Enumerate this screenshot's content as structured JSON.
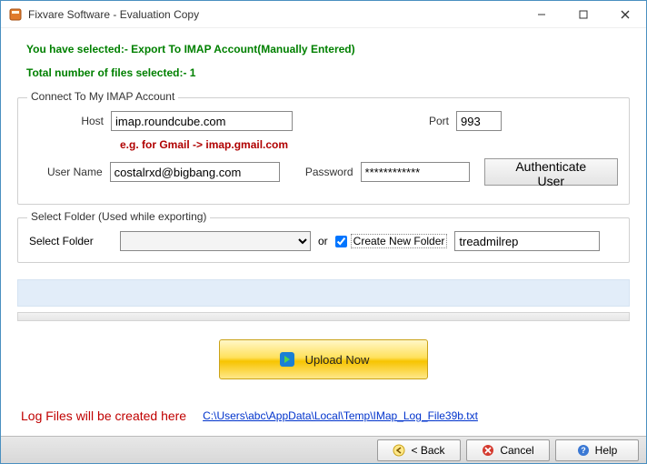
{
  "window": {
    "title": "Fixvare Software - Evaluation Copy"
  },
  "info": {
    "selected": "You have selected:- Export To IMAP Account(Manually Entered)",
    "file_count": "Total number of files selected:- 1"
  },
  "imap": {
    "legend": "Connect To My IMAP Account",
    "host_label": "Host",
    "host_value": "imap.roundcube.com",
    "port_label": "Port",
    "port_value": "993",
    "hint": "e.g. for Gmail -> imap.gmail.com",
    "user_label": "User Name",
    "user_value": "costalrxd@bigbang.com",
    "pass_label": "Password",
    "pass_value": "************",
    "auth_button": "Authenticate User"
  },
  "folder": {
    "legend": "Select Folder (Used while exporting)",
    "select_label": "Select Folder",
    "or": "or",
    "create_label": "Create New Folder",
    "create_checked": true,
    "new_folder_value": "treadmilrep"
  },
  "upload": {
    "label": "Upload Now"
  },
  "log": {
    "label": "Log Files will be created here",
    "path": "C:\\Users\\abc\\AppData\\Local\\Temp\\IMap_Log_File39b.txt"
  },
  "footer": {
    "back": "< Back",
    "cancel": "Cancel",
    "help": "Help"
  }
}
